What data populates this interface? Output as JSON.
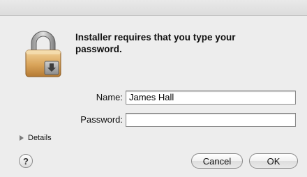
{
  "dialog": {
    "message": "Installer requires that you type your password.",
    "fields": {
      "name_label": "Name:",
      "name_value": "James Hall",
      "password_label": "Password:",
      "password_value": ""
    },
    "details_label": "Details",
    "help_label": "?",
    "buttons": {
      "cancel": "Cancel",
      "ok": "OK"
    },
    "icons": {
      "lock": "padlock-icon",
      "disclosure": "disclosure-triangle-icon",
      "help": "help-icon"
    }
  }
}
